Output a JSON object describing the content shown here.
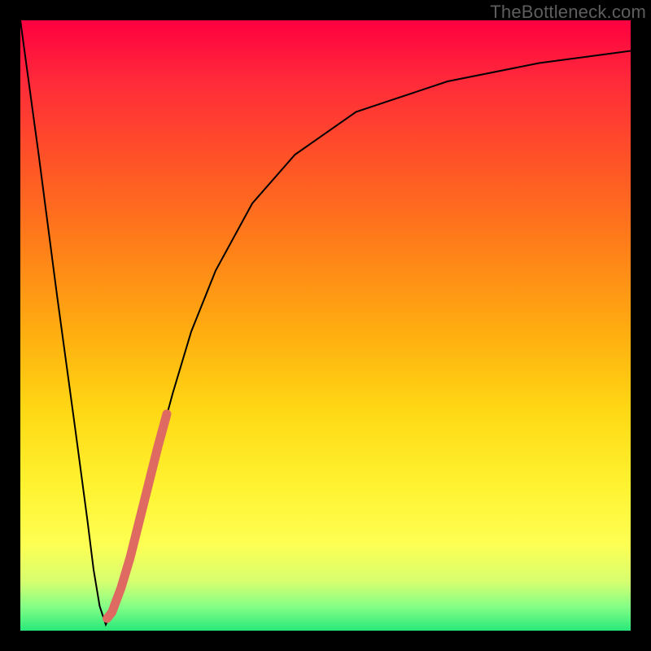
{
  "watermark": "TheBottleneck.com",
  "chart_data": {
    "type": "line",
    "title": "",
    "xlabel": "",
    "ylabel": "",
    "xlim": [
      0,
      100
    ],
    "ylim": [
      0,
      100
    ],
    "grid": false,
    "legend": false,
    "background_gradient_stops": [
      {
        "pos": 0,
        "color": "#ff0040"
      },
      {
        "pos": 10,
        "color": "#ff2a3a"
      },
      {
        "pos": 22,
        "color": "#ff5028"
      },
      {
        "pos": 38,
        "color": "#ff8218"
      },
      {
        "pos": 52,
        "color": "#ffb010"
      },
      {
        "pos": 64,
        "color": "#ffd814"
      },
      {
        "pos": 76,
        "color": "#fff230"
      },
      {
        "pos": 86,
        "color": "#fdff53"
      },
      {
        "pos": 92,
        "color": "#d6ff70"
      },
      {
        "pos": 96,
        "color": "#86ff86"
      },
      {
        "pos": 100,
        "color": "#28e87a"
      }
    ],
    "series": [
      {
        "name": "bottleneck-curve",
        "stroke": "#000000",
        "stroke_width": 2,
        "x": [
          0,
          3,
          6,
          9,
          11,
          12,
          13,
          14,
          16,
          18,
          20,
          22,
          25,
          28,
          32,
          38,
          45,
          55,
          70,
          85,
          100
        ],
        "y": [
          100,
          78,
          55,
          33,
          18,
          10,
          4,
          1,
          5,
          12,
          20,
          28,
          39,
          49,
          59,
          70,
          78,
          85,
          90,
          93,
          95
        ]
      },
      {
        "name": "highlight-segment",
        "stroke": "#de6a62",
        "stroke_width": 11,
        "linecap": "round",
        "x": [
          14.2,
          15.0,
          16.5,
          18.0,
          19.5,
          21.0,
          22.5,
          24.0
        ],
        "y": [
          2.0,
          3.0,
          7.0,
          12.0,
          18.0,
          24.0,
          30.0,
          35.5
        ]
      }
    ]
  }
}
